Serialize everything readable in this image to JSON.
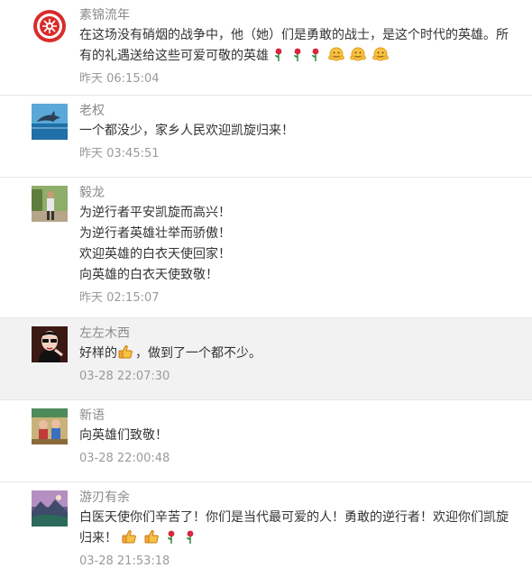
{
  "comments": [
    {
      "name": "素锦流年",
      "avatar_icon": "red-papercut-avatar",
      "lines": [
        "在这场没有硝烟的战争中，他（她）们是勇敢的战士，是这个时代的英雄。所",
        "有的礼遇送给这些可爱可敬的英雄"
      ],
      "line_emojis": [
        [],
        [
          "rose-icon",
          "rose-icon",
          "rose-icon",
          "hug-icon",
          "hug-icon",
          "hug-icon"
        ]
      ],
      "time": "昨天 06:15:04",
      "highlighted": false
    },
    {
      "name": "老权",
      "avatar_icon": "dolphin-avatar",
      "lines": [
        "一个都没少，家乡人民欢迎凯旋归来！"
      ],
      "line_emojis": [
        []
      ],
      "time": "昨天 03:45:51",
      "highlighted": false
    },
    {
      "name": "毅龙",
      "avatar_icon": "person-outdoor-avatar",
      "lines": [
        "为逆行者平安凯旋而高兴！",
        "为逆行者英雄壮举而骄傲！",
        "欢迎英雄的白衣天使回家！",
        "向英雄的白衣天使致敬！"
      ],
      "line_emojis": [
        [],
        [],
        [],
        []
      ],
      "time": "昨天 02:15:07",
      "highlighted": false
    },
    {
      "name": "左左木西",
      "avatar_icon": "sunglasses-girl-avatar",
      "lines": [
        "好样的",
        "，做到了一个都不少。"
      ],
      "inline_emoji": "thumbs-up-icon",
      "line_emojis": [],
      "time": "03-28 22:07:30",
      "highlighted": true
    },
    {
      "name": "新语",
      "avatar_icon": "children-avatar",
      "lines": [
        "向英雄们致敬！"
      ],
      "line_emojis": [
        []
      ],
      "time": "03-28 22:00:48",
      "highlighted": false
    },
    {
      "name": "游刃有余",
      "avatar_icon": "landscape-avatar",
      "lines": [
        "白医天使你们辛苦了！你们是当代最可爱的人！勇敢的逆行者！欢迎你们凯旋",
        "归来！"
      ],
      "line_emojis": [
        [],
        [
          "thumbs-up-icon",
          "thumbs-up-icon",
          "rose-icon",
          "rose-icon"
        ]
      ],
      "time": "03-28 21:53:18",
      "highlighted": false
    }
  ]
}
